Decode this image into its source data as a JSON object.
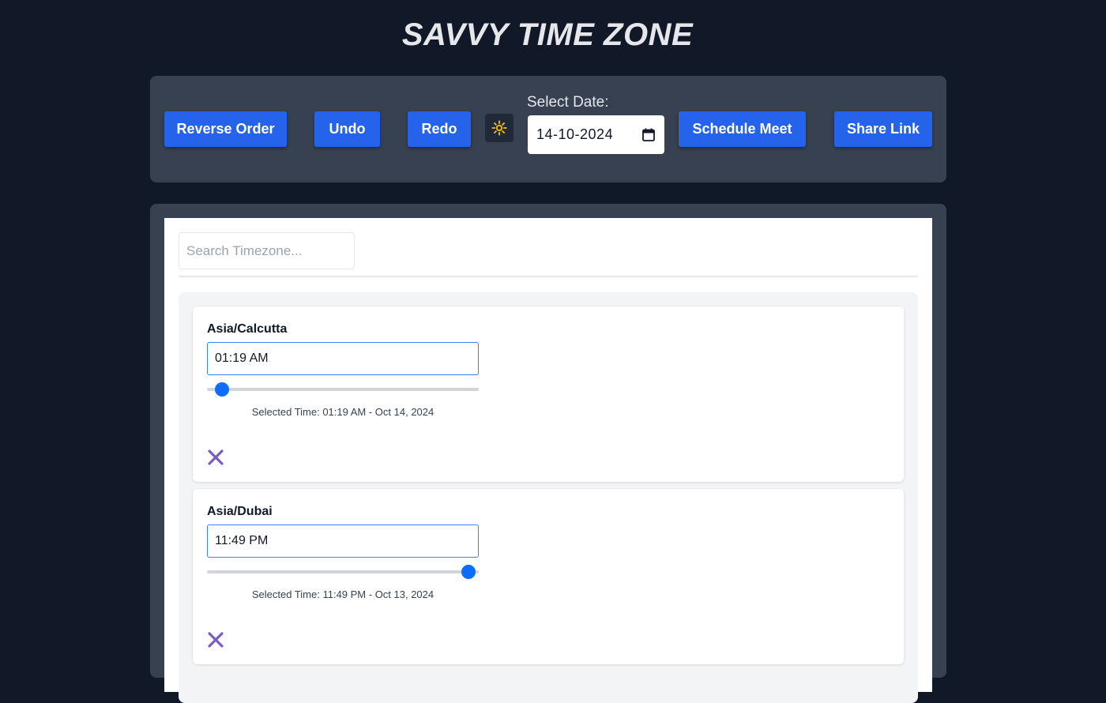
{
  "app": {
    "title": "SAVVY TIME ZONE"
  },
  "toolbar": {
    "reverse_label": "Reverse Order",
    "undo_label": "Undo",
    "redo_label": "Redo",
    "theme_icon": "sun-icon",
    "date_label": "Select Date:",
    "date_value": "14-10-2024",
    "schedule_label": "Schedule Meet",
    "share_label": "Share Link"
  },
  "search": {
    "placeholder": "Search Timezone..."
  },
  "timezones": [
    {
      "name": "Asia/Calcutta",
      "time": "01:19 AM",
      "slider_fraction": 0.055,
      "selected_text": "Selected Time: 01:19 AM - Oct 14, 2024"
    },
    {
      "name": "Asia/Dubai",
      "time": "11:49 PM",
      "slider_fraction": 0.963,
      "selected_text": "Selected Time: 11:49 PM - Oct 13, 2024"
    }
  ],
  "colors": {
    "background": "#111827",
    "panel": "#374151",
    "button": "#2563eb",
    "slider_thumb": "#0d6efd",
    "remove_icon": "#7c5cbf",
    "sun_icon": "#eab308"
  }
}
